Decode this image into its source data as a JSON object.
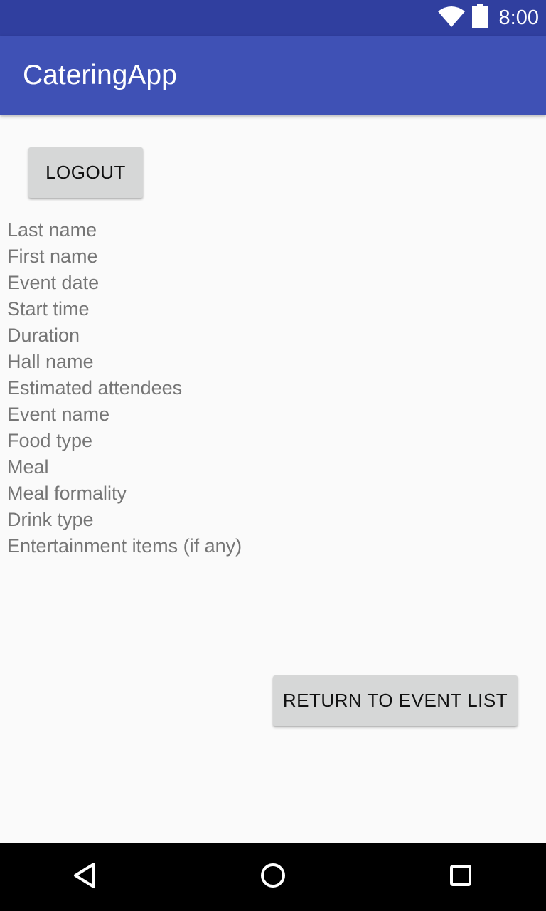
{
  "status_bar": {
    "time": "8:00",
    "icons": [
      "wifi-icon",
      "battery-icon"
    ]
  },
  "app_bar": {
    "title": "CateringApp"
  },
  "actions": {
    "logout_label": "LOGOUT",
    "return_label": "RETURN TO EVENT LIST"
  },
  "fields": [
    {
      "label": "Last name"
    },
    {
      "label": "First name"
    },
    {
      "label": "Event date"
    },
    {
      "label": "Start time"
    },
    {
      "label": "Duration"
    },
    {
      "label": "Hall name"
    },
    {
      "label": "Estimated attendees"
    },
    {
      "label": "Event name"
    },
    {
      "label": "Food type"
    },
    {
      "label": "Meal"
    },
    {
      "label": "Meal formality"
    },
    {
      "label": "Drink type"
    },
    {
      "label": "Entertainment items (if any)"
    }
  ],
  "nav_bar": {
    "icons": [
      "back-icon",
      "home-icon",
      "recents-icon"
    ]
  },
  "colors": {
    "status_bar": "#303f9f",
    "app_bar": "#3f51b5",
    "background": "#fafafa",
    "button": "#d6d7d7",
    "field_text": "#757575"
  }
}
